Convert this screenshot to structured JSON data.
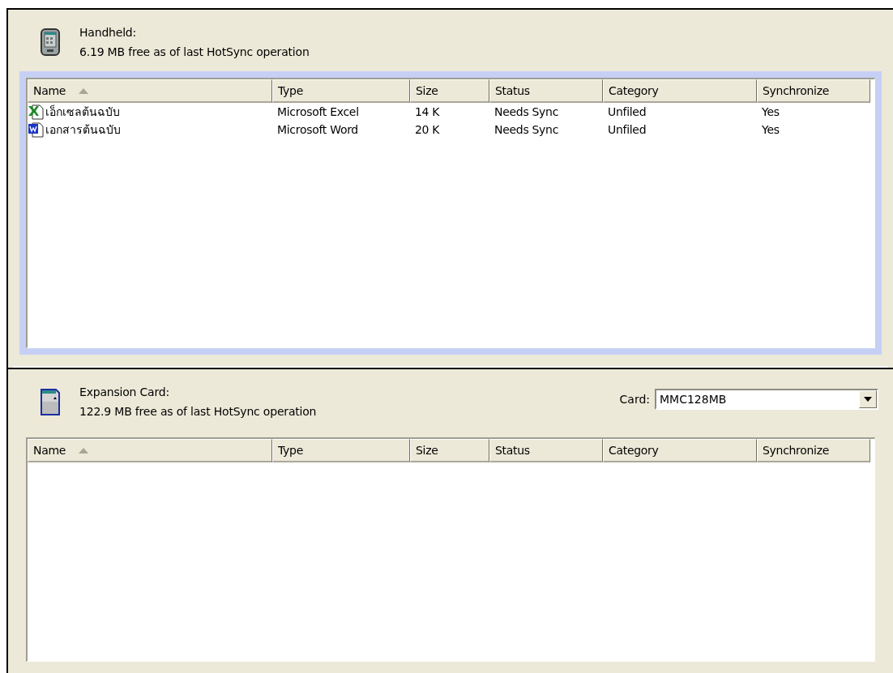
{
  "panels": [
    {
      "kind": "handheld",
      "title": "Handheld:",
      "free": "6.19 MB free as of last HotSync operation",
      "focused": true,
      "columns": [
        {
          "label": "Name",
          "sorted": true
        },
        {
          "label": "Type",
          "sorted": false
        },
        {
          "label": "Size",
          "sorted": false
        },
        {
          "label": "Status",
          "sorted": false
        },
        {
          "label": "Category",
          "sorted": false
        },
        {
          "label": "Synchronize",
          "sorted": false
        }
      ],
      "rows": [
        {
          "kind": "excel",
          "cells": [
            "เอ็กเซลต้นฉบับ",
            "Microsoft Excel",
            "14 K",
            "Needs Sync",
            "Unfiled",
            "Yes"
          ]
        },
        {
          "kind": "word",
          "cells": [
            "เอกสารต้นฉบับ",
            "Microsoft Word",
            "20 K",
            "Needs Sync",
            "Unfiled",
            "Yes"
          ]
        }
      ]
    },
    {
      "kind": "card",
      "title": "Expansion Card:",
      "free": "122.9 MB free as of last HotSync operation",
      "focused": false,
      "card_select": {
        "label": "Card:",
        "value": "MMC128MB"
      },
      "columns": [
        {
          "label": "Name",
          "sorted": true
        },
        {
          "label": "Type",
          "sorted": false
        },
        {
          "label": "Size",
          "sorted": false
        },
        {
          "label": "Status",
          "sorted": false
        },
        {
          "label": "Category",
          "sorted": false
        },
        {
          "label": "Synchronize",
          "sorted": false
        }
      ]
    }
  ]
}
